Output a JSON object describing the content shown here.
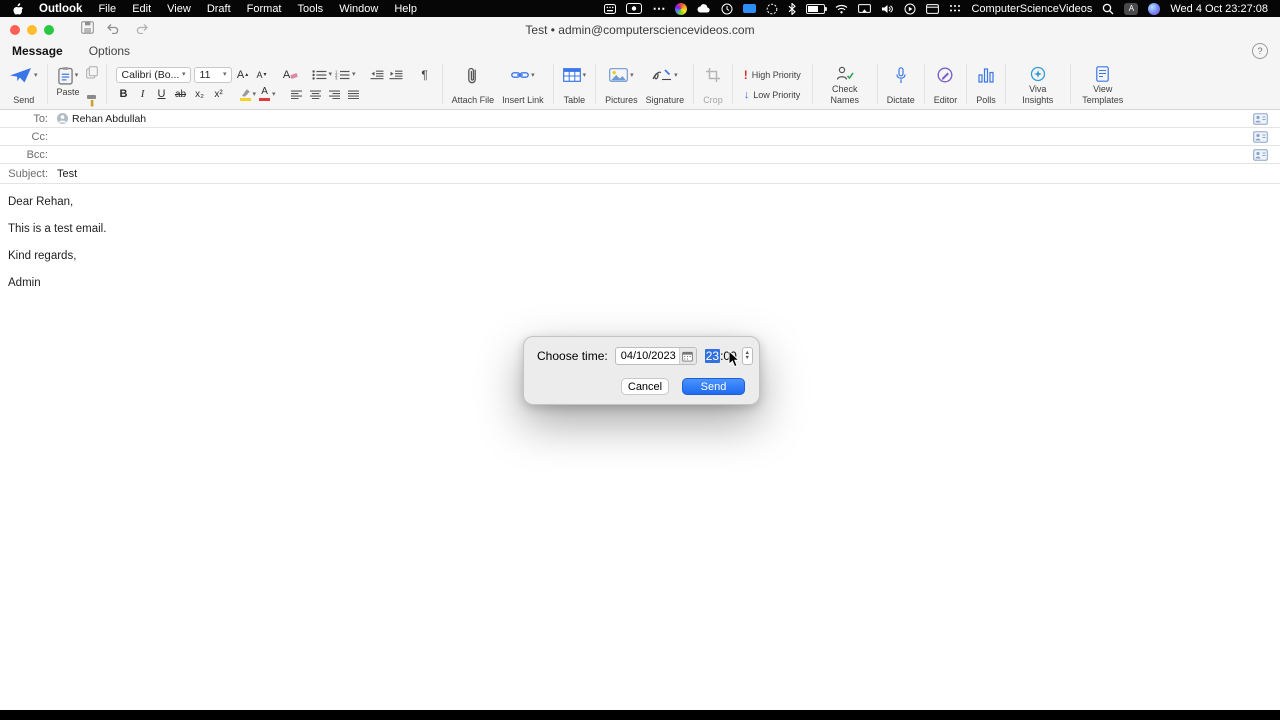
{
  "menu_bar": {
    "app_name": "Outlook",
    "menus": [
      "File",
      "Edit",
      "View",
      "Draft",
      "Format",
      "Tools",
      "Window",
      "Help"
    ],
    "status_text": "ComputerScienceVideos",
    "clock": "Wed 4 Oct 23:27:08"
  },
  "title_bar": {
    "title": "Test • admin@computersciencevideos.com"
  },
  "tabs": {
    "message": "Message",
    "options": "Options"
  },
  "ribbon": {
    "send": "Send",
    "paste": "Paste",
    "font_name": "Calibri (Bo...",
    "font_size": "11",
    "attach_file": "Attach File",
    "insert_link": "Insert Link",
    "table": "Table",
    "pictures": "Pictures",
    "signature": "Signature",
    "crop": "Crop",
    "high_priority": "High Priority",
    "low_priority": "Low Priority",
    "check_names": "Check Names",
    "dictate": "Dictate",
    "editor": "Editor",
    "polls": "Polls",
    "viva_insights": "Viva Insights",
    "view_templates": "View Templates"
  },
  "compose": {
    "to_label": "To:",
    "to_value": "Rehan Abdullah",
    "cc_label": "Cc:",
    "bcc_label": "Bcc:",
    "subject_label": "Subject:",
    "subject_value": "Test",
    "body": [
      "Dear Rehan,",
      "This is a test email.",
      "Kind regards,",
      "Admin"
    ]
  },
  "dialog": {
    "label": "Choose time:",
    "date": "04/10/2023",
    "hour": "23",
    "separator": ":",
    "minute": "00",
    "cancel": "Cancel",
    "send": "Send"
  },
  "glyphs": {
    "caret": "▾",
    "up_small": "▴",
    "bold": "B",
    "italic": "I",
    "underline": "U",
    "strikethrough": "ab",
    "subscript": "x₂",
    "superscript": "x²",
    "paragraph_mark": "¶",
    "font_letter": "A",
    "high_priority_mark": "!",
    "low_priority_mark": "↓",
    "help": "?",
    "more": "⋯",
    "stepper_up": "▲",
    "stepper_down": "▼"
  },
  "colors": {
    "accent_blue": "#2f6ede",
    "selection_blue": "#3272e0",
    "send_button_top": "#4a93ff",
    "send_button_bottom": "#1e6bf1",
    "traffic_red": "#ff5f57",
    "traffic_yellow": "#febc2e",
    "traffic_green": "#28c840",
    "font_color_red": "#e03a3a",
    "highlight_yellow": "#f3d32a",
    "high_priority_red": "#d93025"
  }
}
